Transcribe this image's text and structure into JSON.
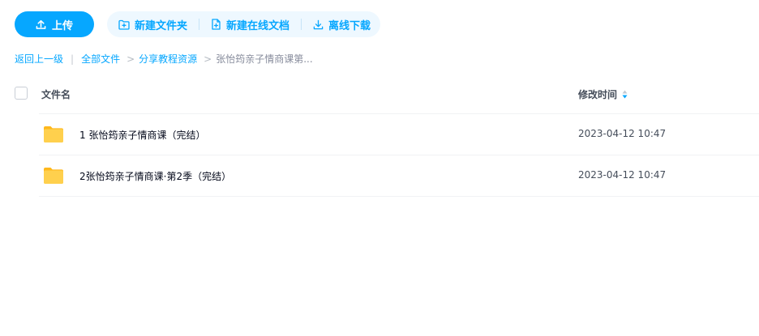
{
  "toolbar": {
    "upload_label": "上传",
    "new_folder_label": "新建文件夹",
    "new_doc_label": "新建在线文档",
    "offline_download_label": "离线下载"
  },
  "breadcrumb": {
    "back_label": "返回上一级",
    "all_files_label": "全部文件",
    "shared_resources_label": "分享教程资源",
    "current_label": "张怡筠亲子情商课第..."
  },
  "table": {
    "name_header": "文件名",
    "time_header": "修改时间",
    "rows": [
      {
        "name": "1 张怡筠亲子情商课（完结）",
        "time": "2023-04-12 10:47"
      },
      {
        "name": "2张怡筠亲子情商课·第2季（完结）",
        "time": "2023-04-12 10:47"
      }
    ]
  },
  "colors": {
    "accent": "#06a7ff",
    "accent_light": "#eef8ff",
    "folder": "#ffc83d"
  }
}
